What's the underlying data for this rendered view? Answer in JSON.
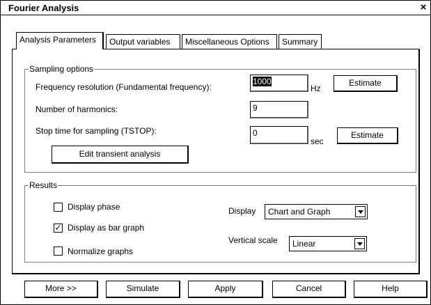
{
  "window": {
    "title": "Fourier Analysis",
    "close_symbol": "×"
  },
  "tabs": [
    {
      "label": "Analysis Parameters",
      "active": true
    },
    {
      "label": "Output variables"
    },
    {
      "label": "Miscellaneous Options"
    },
    {
      "label": "Summary"
    }
  ],
  "sampling": {
    "legend": "Sampling options",
    "freq_label": "Frequency resolution (Fundamental frequency):",
    "freq_value": "1000",
    "freq_unit": "Hz",
    "estimate1_label": "Estimate",
    "harmonics_label": "Number of harmonics:",
    "harmonics_value": "9",
    "stop_label": "Stop time for sampling (TSTOP):",
    "stop_value": "0",
    "stop_unit": "sec",
    "estimate2_label": "Estimate",
    "edit_transient_label": "Edit transient analysis"
  },
  "results": {
    "legend": "Results",
    "display_phase": {
      "label": "Display phase",
      "checked": false
    },
    "display_bar": {
      "label": "Display as bar graph",
      "checked": true
    },
    "normalize": {
      "label": "Normalize graphs",
      "checked": false
    },
    "display_label": "Display",
    "display_value": "Chart and Graph",
    "vscale_label": "Vertical scale",
    "vscale_value": "Linear",
    "check_mark": "✓"
  },
  "buttons": {
    "more": "More >>",
    "simulate": "Simulate",
    "apply": "Apply",
    "cancel": "Cancel",
    "help": "Help"
  }
}
